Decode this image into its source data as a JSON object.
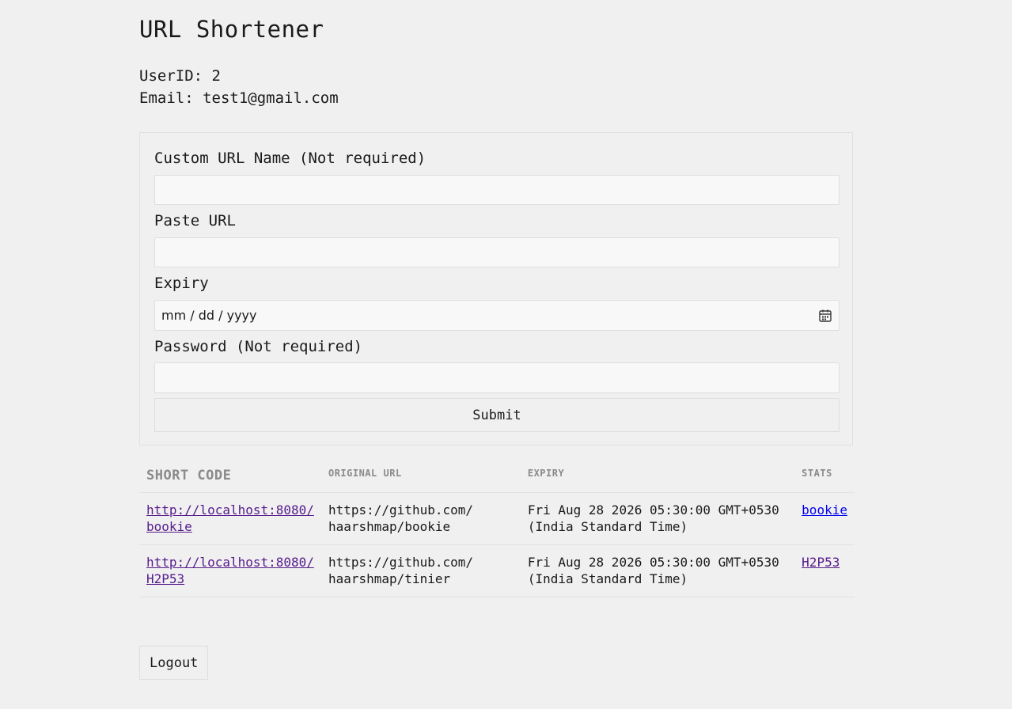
{
  "title": "URL Shortener",
  "user": {
    "id_line": "UserID: 2",
    "email_line": "Email: test1@gmail.com"
  },
  "form": {
    "custom_name_label": "Custom URL Name (Not required)",
    "custom_name_value": "",
    "paste_url_label": "Paste URL",
    "paste_url_value": "",
    "expiry_label": "Expiry",
    "expiry_placeholder": "mm / dd / yyyy",
    "password_label": "Password (Not required)",
    "password_value": "",
    "submit_label": "Submit"
  },
  "table": {
    "headers": {
      "short_code": "SHORT CODE",
      "original_url": "ORIGINAL URL",
      "expiry": "EXPIRY",
      "stats": "STATS"
    },
    "rows": [
      {
        "short_line1": "http://localhost:8080/",
        "short_line2": "bookie",
        "orig_line1": "https://github.com/",
        "orig_line2": "haarshmap/bookie",
        "expiry_line1": "Fri Aug 28 2026 05:30:00 GMT+0530",
        "expiry_line2": "(India Standard Time)",
        "stats": "bookie"
      },
      {
        "short_line1": "http://localhost:8080/",
        "short_line2": "H2P53",
        "orig_line1": "https://github.com/",
        "orig_line2": "haarshmap/tinier",
        "expiry_line1": "Fri Aug 28 2026 05:30:00 GMT+0530",
        "expiry_line2": "(India Standard Time)",
        "stats": "H2P53"
      }
    ]
  },
  "logout_label": "Logout",
  "colors": {
    "background": "#f0f0f0",
    "visited_link": "#551a8b",
    "link": "#0000ee",
    "header_text": "#8a8a8a"
  }
}
